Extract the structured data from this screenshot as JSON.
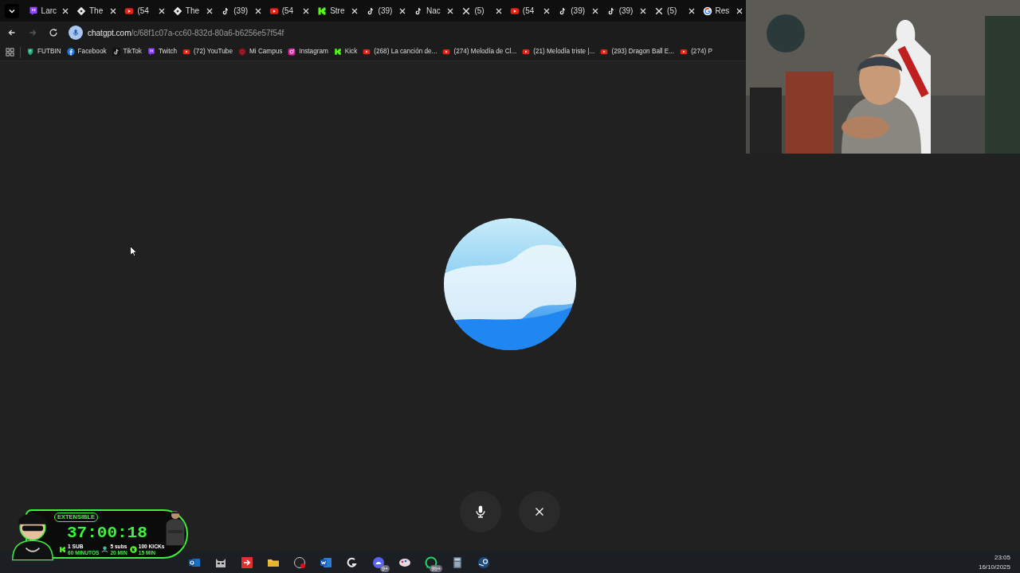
{
  "tabs": [
    {
      "kind": "twitch",
      "label": "Larc"
    },
    {
      "kind": "diamond",
      "label": "The"
    },
    {
      "kind": "youtube",
      "label": "(54"
    },
    {
      "kind": "diamond",
      "label": "The"
    },
    {
      "kind": "tiktok",
      "label": "(39)"
    },
    {
      "kind": "youtube",
      "label": "(54"
    },
    {
      "kind": "kick",
      "label": "Stre"
    },
    {
      "kind": "tiktok",
      "label": "(39)"
    },
    {
      "kind": "tiktok",
      "label": "Nac"
    },
    {
      "kind": "x",
      "label": "(5)"
    },
    {
      "kind": "youtube",
      "label": "(54"
    },
    {
      "kind": "tiktok",
      "label": "(39)"
    },
    {
      "kind": "tiktok",
      "label": "(39)"
    },
    {
      "kind": "x",
      "label": "(5)"
    },
    {
      "kind": "google",
      "label": "Res"
    }
  ],
  "nav": [
    {
      "kind": "back",
      "disabled": false
    },
    {
      "kind": "forward",
      "disabled": true
    },
    {
      "kind": "reload",
      "disabled": false
    }
  ],
  "address": {
    "host": "chatgpt.com",
    "path": "/c/68f1c07a-cc60-832d-80a6-b6256e57f54f"
  },
  "bookmarks": [
    {
      "kind": "futbin",
      "label": "FUTBIN"
    },
    {
      "kind": "facebook",
      "label": "Facebook"
    },
    {
      "kind": "tiktok",
      "label": "TikTok"
    },
    {
      "kind": "twitch",
      "label": "Twitch"
    },
    {
      "kind": "youtube",
      "label": "(72) YouTube"
    },
    {
      "kind": "campus",
      "label": "Mi Campus"
    },
    {
      "kind": "instagram",
      "label": "Instagram"
    },
    {
      "kind": "kick",
      "label": "Kick"
    },
    {
      "kind": "youtube",
      "label": "(268) La canción de..."
    },
    {
      "kind": "youtube",
      "label": "(274) Melodía de Cl..."
    },
    {
      "kind": "youtube",
      "label": "(21) Melodía triste |..."
    },
    {
      "kind": "youtube",
      "label": "(293) Dragon Ball E..."
    },
    {
      "kind": "youtube",
      "label": "(274) P"
    }
  ],
  "voice_buttons": [
    {
      "kind": "mic"
    },
    {
      "kind": "close"
    }
  ],
  "overlay": {
    "badge": "EXTENSIBLE",
    "timer": "37:00:18",
    "goals": [
      {
        "kind": "kick",
        "line1": "1 SUB",
        "line2": "60 MINUTOS"
      },
      {
        "kind": "sub",
        "line1": "5 subs",
        "line2": "20 MIN"
      },
      {
        "kind": "kickcircle",
        "line1": "100 KICKs",
        "line2": "15 MIN"
      }
    ]
  },
  "taskbar": {
    "apps": [
      {
        "kind": "outlook"
      },
      {
        "kind": "cat"
      },
      {
        "kind": "redapp"
      },
      {
        "kind": "folder"
      },
      {
        "kind": "obs"
      },
      {
        "kind": "word"
      },
      {
        "kind": "logitech"
      },
      {
        "kind": "discord",
        "badge": "9+"
      },
      {
        "kind": "paint"
      },
      {
        "kind": "whatsapp",
        "badge": "99+"
      },
      {
        "kind": "calculator"
      },
      {
        "kind": "steam"
      }
    ],
    "clock": {
      "time": "23:05",
      "date": "16/10/2025"
    }
  }
}
